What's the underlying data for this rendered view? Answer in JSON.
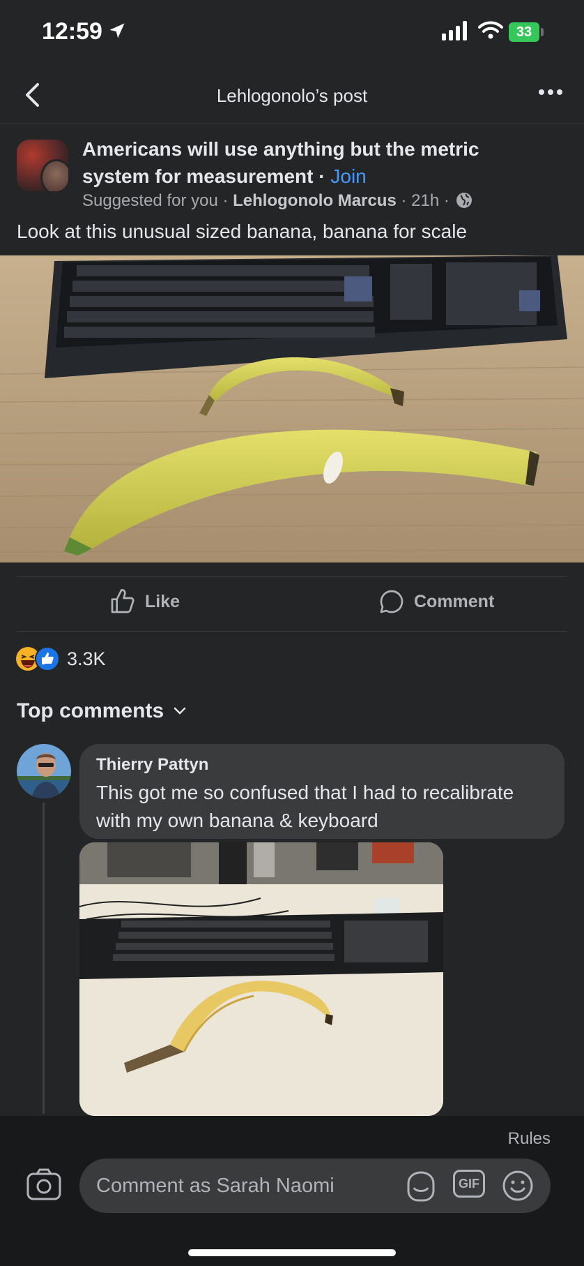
{
  "status_bar": {
    "time": "12:59",
    "battery": "33"
  },
  "header": {
    "title": "Lehlogonolo’s post"
  },
  "post": {
    "group_name": "Americans will use anything but the metric system for measurement",
    "separator": " · ",
    "join_label": "Join",
    "meta_prefix": "Suggested for you · ",
    "author": "Lehlogonolo Marcus",
    "meta_suffix": " · 21h · ",
    "text": "Look at this unusual sized banana, banana for scale"
  },
  "actions": {
    "like_label": "Like",
    "comment_label": "Comment"
  },
  "reactions": {
    "count": "3.3K"
  },
  "comments": {
    "heading": "Top comments",
    "items": [
      {
        "name": "Thierry Pattyn",
        "text": "This got me so confused that I had to recalibrate with my own banana & keyboard"
      }
    ]
  },
  "composer": {
    "rules_label": "Rules",
    "placeholder": "Comment as Sarah Naomi",
    "gif_label": "GIF"
  },
  "colors": {
    "background": "#242526",
    "accent": "#4599ff",
    "bubble": "#3a3b3c"
  }
}
